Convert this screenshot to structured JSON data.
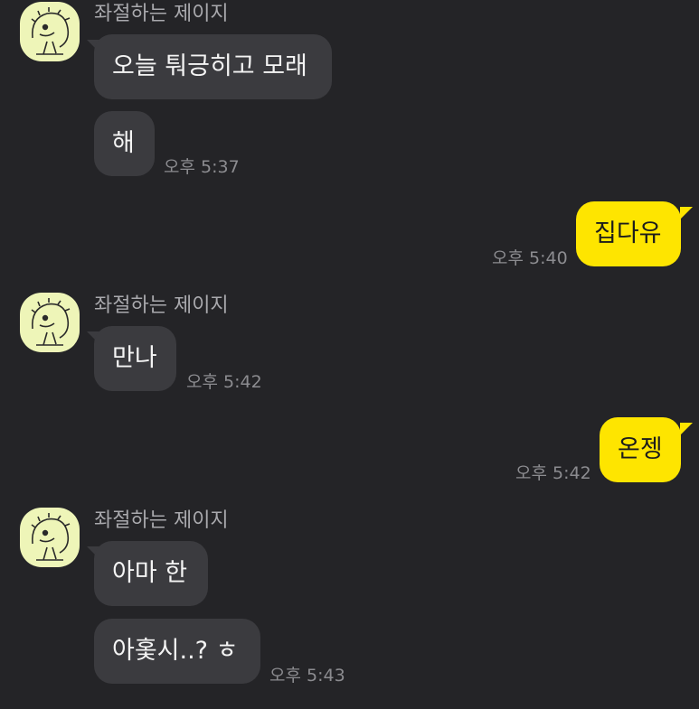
{
  "sender_name": "좌절하는 제이지",
  "groups": [
    {
      "direction": "in",
      "messages": [
        "오늘 퉈긍히고 모래",
        "해"
      ],
      "time": "오후 5:37"
    },
    {
      "direction": "out",
      "messages": [
        "집다유"
      ],
      "time": "오후 5:40"
    },
    {
      "direction": "in",
      "messages": [
        "만나"
      ],
      "time": "오후 5:42"
    },
    {
      "direction": "out",
      "messages": [
        "온젱"
      ],
      "time": "오후 5:42"
    },
    {
      "direction": "in",
      "messages": [
        "아마 한",
        "아홏시..? ㅎ"
      ],
      "time": "오후 5:43"
    }
  ],
  "colors": {
    "background": "#242427",
    "incoming_bubble": "#3b3b3f",
    "outgoing_bubble": "#fee500",
    "avatar_bg": "#eef5b8"
  }
}
